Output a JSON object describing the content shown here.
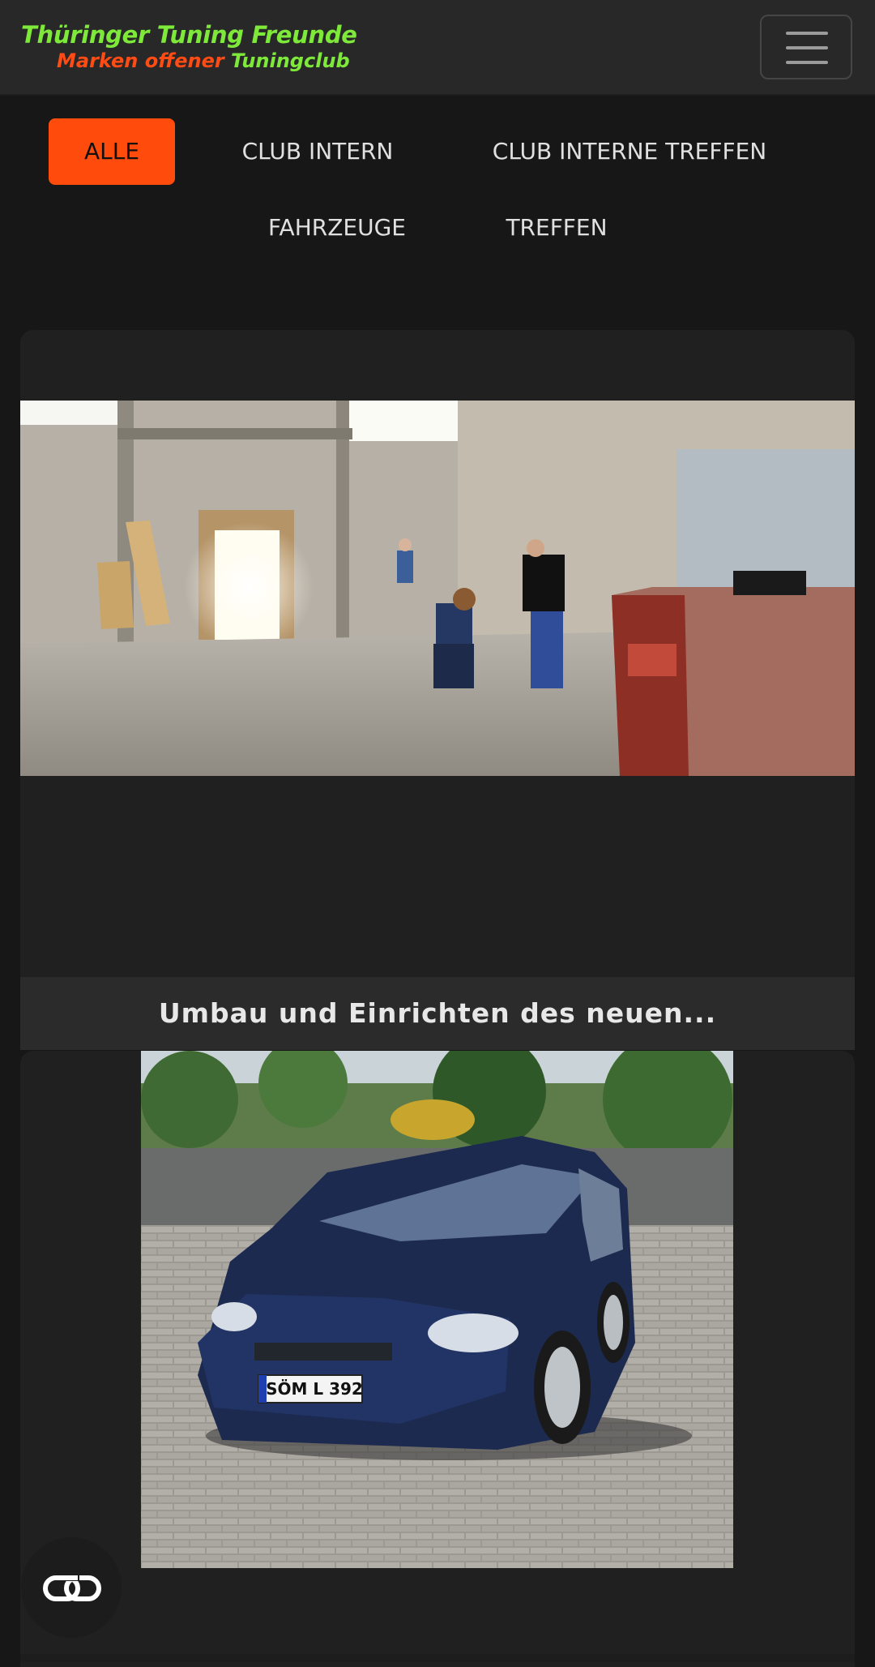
{
  "header": {
    "brand_line1": "Thüringer Tuning Freunde",
    "brand_line2_part1": "Marken offener",
    "brand_line2_part2": "Tuningclub",
    "menu_icon": "hamburger-menu-icon"
  },
  "filters": [
    {
      "label": "ALLE",
      "active": true
    },
    {
      "label": "CLUB INTERN",
      "active": false
    },
    {
      "label": "CLUB INTERNE TREFFEN",
      "active": false
    },
    {
      "label": "FAHRZEUGE",
      "active": false
    },
    {
      "label": "TREFFEN",
      "active": false
    }
  ],
  "posts": [
    {
      "title": "Umbau und Einrichten des neuen...",
      "image": "warehouse-renovation-photo"
    },
    {
      "image": "blue-ford-focus-photo",
      "plate": "SÖM L 392"
    }
  ],
  "fab_icon": "link-icon",
  "colors": {
    "accent": "#ff4c0c",
    "brand_green": "#7ee93a",
    "brand_orange": "#ff4b14",
    "background": "#171717",
    "header_bg": "#282828"
  }
}
